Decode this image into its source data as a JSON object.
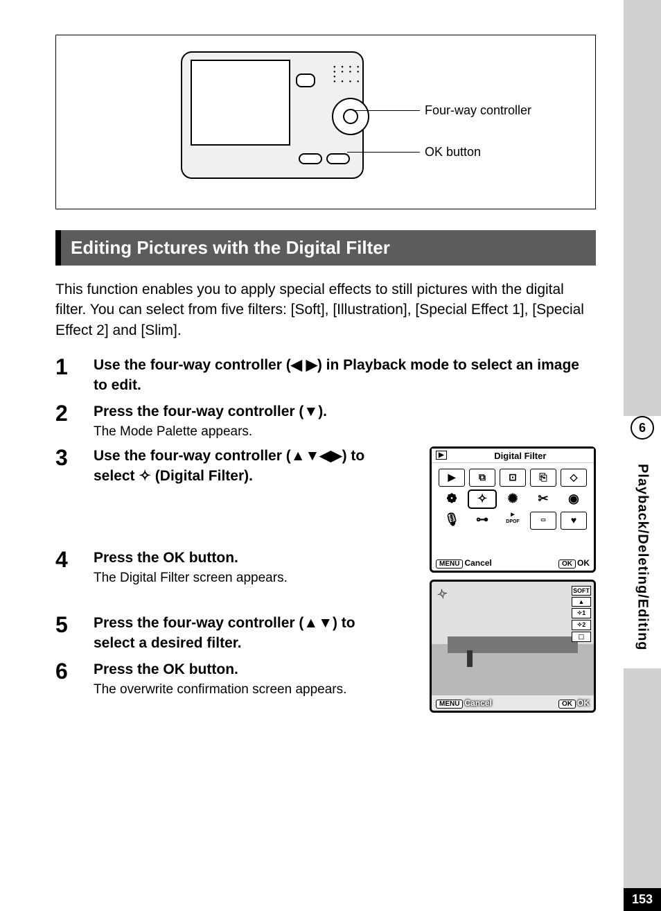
{
  "diagram": {
    "label1": "Four-way controller",
    "label2": "OK button"
  },
  "section_title": "Editing Pictures with the Digital Filter",
  "intro": "This function enables you to apply special effects to still pictures with the digital filter. You can select from five filters: [Soft], [Illustration], [Special Effect 1], [Special Effect 2] and [Slim].",
  "steps": [
    {
      "n": "1",
      "title": "Use the four-way controller (◀ ▶) in Playback mode to select an image to edit.",
      "sub": ""
    },
    {
      "n": "2",
      "title": "Press the four-way controller (▼).",
      "sub": "The Mode Palette appears."
    },
    {
      "n": "3",
      "title": "Use the four-way controller (▲▼◀▶) to select ✧ (Digital Filter).",
      "sub": ""
    },
    {
      "n": "4",
      "title": "Press the OK button.",
      "sub": "The Digital Filter screen appears."
    },
    {
      "n": "5",
      "title": "Press the four-way controller (▲▼) to select a desired filter.",
      "sub": ""
    },
    {
      "n": "6",
      "title": "Press the OK button.",
      "sub": "The overwrite confirmation screen appears."
    }
  ],
  "screen1": {
    "title": "Digital Filter",
    "cancel_btn": "MENU",
    "cancel": "Cancel",
    "ok_btn": "OK",
    "ok": "OK",
    "dpof": "DPOF"
  },
  "screen2": {
    "soft": "SOFT",
    "f1": "✧1",
    "f2": "✧2",
    "cancel_btn": "MENU",
    "cancel": "Cancel",
    "ok_btn": "OK",
    "ok": "OK"
  },
  "tab": {
    "number": "6",
    "text": "Playback/Deleting/Editing"
  },
  "page_number": "153"
}
